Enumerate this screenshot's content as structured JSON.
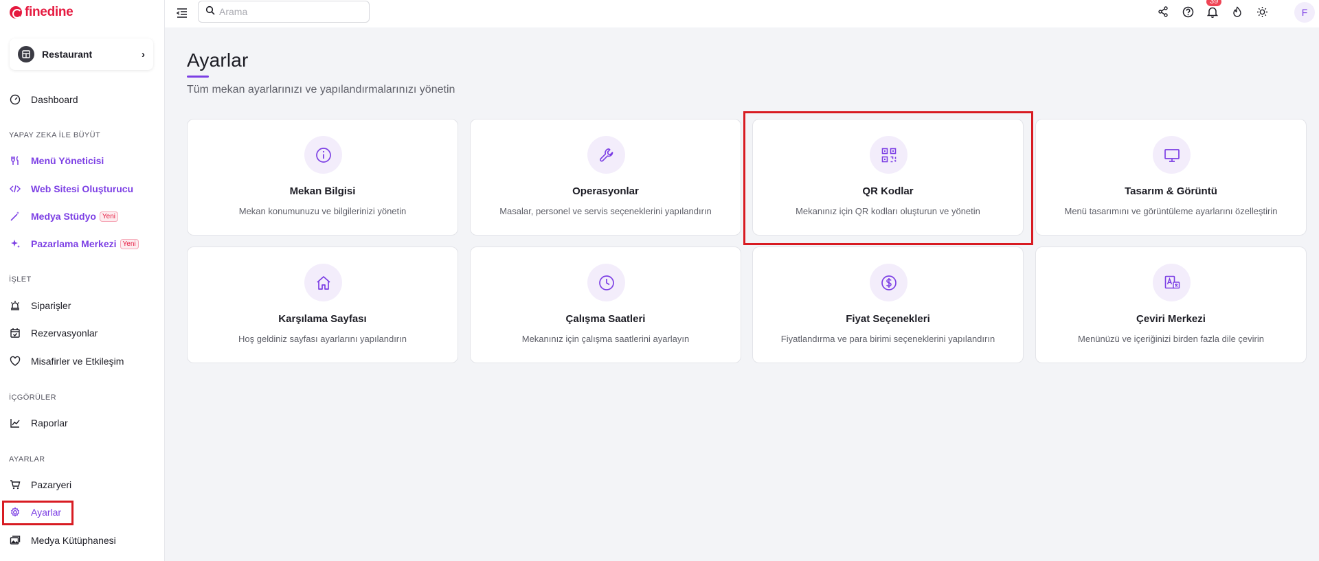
{
  "brand": {
    "name": "finedine",
    "color": "#e5193f"
  },
  "accent": "#7c3fe4",
  "venue": {
    "label": "Restaurant",
    "icon": "store-icon"
  },
  "sidebar": {
    "dashboard": "Dashboard",
    "sections": {
      "ai": "YAPAY ZEKA İLE BÜYÜT",
      "operate": "İŞLET",
      "insights": "İÇGÖRÜLER",
      "settings": "AYARLAR"
    },
    "ai_items": [
      {
        "label": "Menü Yöneticisi",
        "icon": "fork-knife-icon"
      },
      {
        "label": "Web Sitesi Oluşturucu",
        "icon": "code-icon"
      },
      {
        "label": "Medya Stüdyo",
        "icon": "magic-wand-icon",
        "badge": "Yeni"
      },
      {
        "label": "Pazarlama Merkezi",
        "icon": "sparkle-icon",
        "badge": "Yeni"
      }
    ],
    "operate_items": [
      {
        "label": "Siparişler",
        "icon": "bell-alarm-icon"
      },
      {
        "label": "Rezervasyonlar",
        "icon": "calendar-check-icon"
      },
      {
        "label": "Misafirler ve Etkileşim",
        "icon": "heart-icon"
      }
    ],
    "insights_items": [
      {
        "label": "Raporlar",
        "icon": "chart-line-icon"
      }
    ],
    "settings_items": [
      {
        "label": "Pazaryeri",
        "icon": "cart-icon"
      },
      {
        "label": "Ayarlar",
        "icon": "gear-icon",
        "active": true
      },
      {
        "label": "Medya Kütüphanesi",
        "icon": "images-icon"
      }
    ]
  },
  "topbar": {
    "search_placeholder": "Arama",
    "notification_count": "39",
    "avatar_initial": "F"
  },
  "page": {
    "title": "Ayarlar",
    "subtitle": "Tüm mekan ayarlarınızı ve yapılandırmalarınızı yönetin"
  },
  "cards": [
    {
      "title": "Mekan Bilgisi",
      "desc": "Mekan konumunuzu ve bilgilerinizi yönetin",
      "icon": "info-icon"
    },
    {
      "title": "Operasyonlar",
      "desc": "Masalar, personel ve servis seçeneklerini yapılandırın",
      "icon": "wrench-icon"
    },
    {
      "title": "QR Kodlar",
      "desc": "Mekanınız için QR kodları oluşturun ve yönetin",
      "icon": "qr-code-icon",
      "highlighted": true
    },
    {
      "title": "Tasarım & Görüntü",
      "desc": "Menü tasarımını ve görüntüleme ayarlarını özelleştirin",
      "icon": "monitor-icon"
    },
    {
      "title": "Karşılama Sayfası",
      "desc": "Hoş geldiniz sayfası ayarlarını yapılandırın",
      "icon": "home-icon"
    },
    {
      "title": "Çalışma Saatleri",
      "desc": "Mekanınız için çalışma saatlerini ayarlayın",
      "icon": "clock-icon"
    },
    {
      "title": "Fiyat Seçenekleri",
      "desc": "Fiyatlandırma ve para birimi seçeneklerini yapılandırın",
      "icon": "dollar-circle-icon"
    },
    {
      "title": "Çeviri Merkezi",
      "desc": "Menünüzü ve içeriğinizi birden fazla dile çevirin",
      "icon": "translate-icon"
    }
  ],
  "highlight_color": "#d81b22"
}
